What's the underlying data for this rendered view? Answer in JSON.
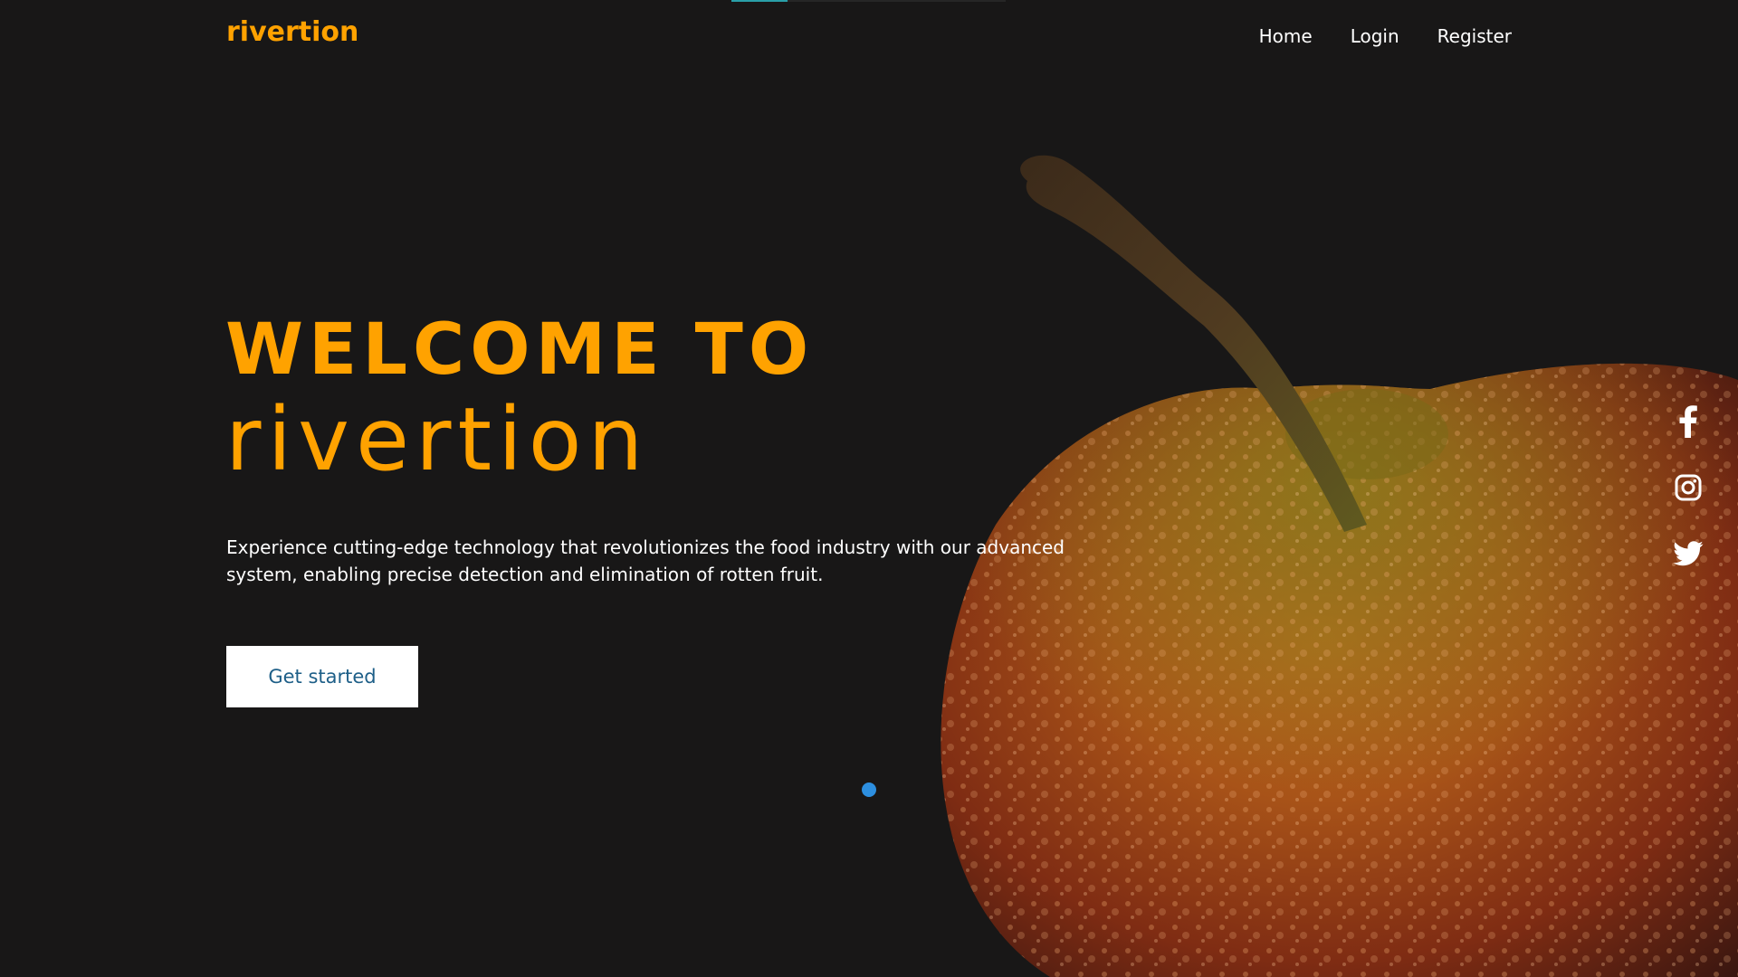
{
  "header": {
    "brand": "rivertion",
    "nav": [
      "Home",
      "Login",
      "Register"
    ]
  },
  "hero": {
    "welcome": "WELCOME TO",
    "name": "rivertion",
    "description": "Experience cutting-edge technology that revolutionizes the food industry with our advanced system, enabling precise detection and elimination of rotten fruit.",
    "cta_label": "Get started"
  },
  "social": {
    "icons": [
      "facebook-icon",
      "instagram-icon",
      "twitter-icon"
    ]
  },
  "colors": {
    "accent": "#ffa200",
    "background": "#181717",
    "cta_text": "#1e5f88",
    "indicator": "#2d8fe0"
  }
}
